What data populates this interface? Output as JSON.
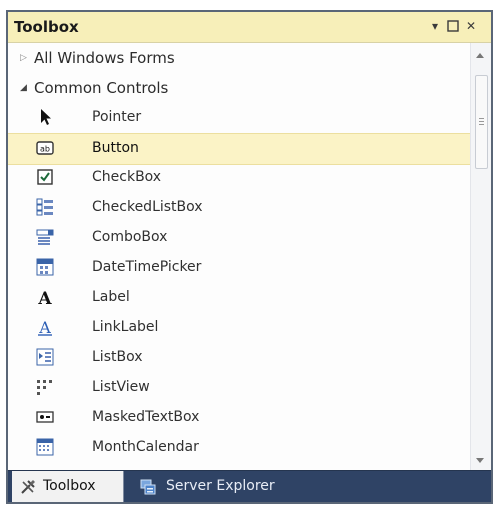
{
  "window": {
    "title": "Toolbox",
    "controls": [
      "pin",
      "maximize",
      "close"
    ]
  },
  "groups": [
    {
      "label": "All Windows Forms",
      "expanded": false
    },
    {
      "label": "Common Controls",
      "expanded": true
    }
  ],
  "items": [
    {
      "label": "Pointer",
      "icon": "pointer-icon"
    },
    {
      "label": "Button",
      "icon": "button-icon",
      "selected": true
    },
    {
      "label": "CheckBox",
      "icon": "checkbox-icon"
    },
    {
      "label": "CheckedListBox",
      "icon": "checked-list-box-icon"
    },
    {
      "label": "ComboBox",
      "icon": "combo-box-icon"
    },
    {
      "label": "DateTimePicker",
      "icon": "date-time-picker-icon"
    },
    {
      "label": "Label",
      "icon": "label-icon"
    },
    {
      "label": "LinkLabel",
      "icon": "link-label-icon"
    },
    {
      "label": "ListBox",
      "icon": "list-box-icon"
    },
    {
      "label": "ListView",
      "icon": "list-view-icon"
    },
    {
      "label": "MaskedTextBox",
      "icon": "masked-text-box-icon"
    },
    {
      "label": "MonthCalendar",
      "icon": "month-calendar-icon"
    }
  ],
  "tabs": [
    {
      "label": "Toolbox",
      "active": true
    },
    {
      "label": "Server Explorer",
      "active": false
    }
  ],
  "colors": {
    "title_bar": "#f7efb9",
    "selected_row": "#fbf3c6",
    "tab_bar": "#2f4365"
  }
}
